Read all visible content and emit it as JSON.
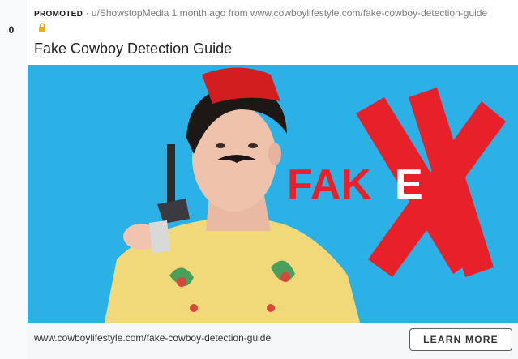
{
  "post": {
    "score": "0",
    "promoted_label": "PROMOTED",
    "separator": " · ",
    "author": "u/ShowstopMedia",
    "time_text": "1 month ago from",
    "source_url": "www.cowboylifestyle.com/fake-cowboy-detection-guide",
    "title": "Fake Cowboy Detection Guide"
  },
  "image": {
    "overlay_text_left": "FAK",
    "overlay_text_right": "E"
  },
  "footer": {
    "link_text": "www.cowboylifestyle.com/fake-cowboy-detection-guide",
    "cta_label": "LEARN MORE"
  },
  "colors": {
    "arrow": "#878a8c",
    "accent_red": "#e8202a",
    "sky": "#2cb1e6",
    "lock": "#e6b400"
  },
  "icons": [
    "upvote-arrow-icon",
    "downvote-arrow-icon",
    "lock-icon"
  ]
}
